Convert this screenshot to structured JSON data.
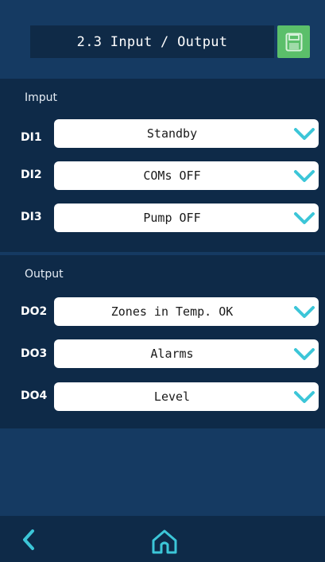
{
  "header": {
    "title": "2.3 Input / Output",
    "save_icon": "floppy-disk-icon"
  },
  "colors": {
    "background": "#153a62",
    "panel": "#0e2a48",
    "accent": "#3cc6d8",
    "save_green": "#5bbf6a"
  },
  "input_section": {
    "title": "Imput",
    "rows": [
      {
        "label": "DI1",
        "value": "Standby"
      },
      {
        "label": "DI2",
        "value": "COMs OFF"
      },
      {
        "label": "DI3",
        "value": "Pump OFF"
      }
    ]
  },
  "output_section": {
    "title": "Output",
    "rows": [
      {
        "label": "DO2",
        "value": "Zones in Temp. OK"
      },
      {
        "label": "DO3",
        "value": "Alarms"
      },
      {
        "label": "DO4",
        "value": "Level"
      }
    ]
  },
  "footer": {
    "back_icon": "chevron-left-icon",
    "home_icon": "home-icon"
  }
}
